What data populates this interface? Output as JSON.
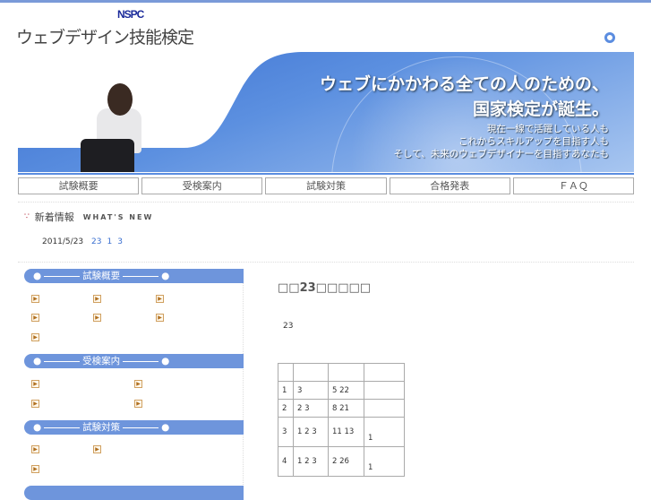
{
  "header": {
    "logo": "NSPC",
    "title": "ウェブデザイン技能検定"
  },
  "banner": {
    "headline1": "ウェブにかかわる全ての人のための、",
    "headline2": "国家検定が誕生。",
    "sub1": "現在一線で活躍している人も",
    "sub2": "これからスキルアップを目指す人も",
    "sub3": "そして、未来のウェブデザイナーを目指すあなたも"
  },
  "nav": [
    "試験概要",
    "受検案内",
    "試験対策",
    "合格発表",
    "ＦＡＱ"
  ],
  "news": {
    "title": "新着情報",
    "title_en": "WHAT'S NEW",
    "items": [
      {
        "date": "2011/5/23",
        "link1": "23",
        "link2": "1",
        "link3": "3"
      }
    ]
  },
  "sidebar": {
    "sections": [
      "試験概要",
      "受検案内",
      "試験対策"
    ]
  },
  "content": {
    "title": "□□23□□□□□",
    "text": "23",
    "table": [
      [
        "",
        "",
        "",
        ""
      ],
      [
        "1",
        "3",
        "5 22",
        ""
      ],
      [
        "2",
        "2 3",
        "8 21",
        ""
      ],
      [
        "3",
        "1   2 3",
        "11 13",
        "1"
      ],
      [
        "4",
        "1   2 3",
        "2 26",
        "1"
      ]
    ]
  }
}
